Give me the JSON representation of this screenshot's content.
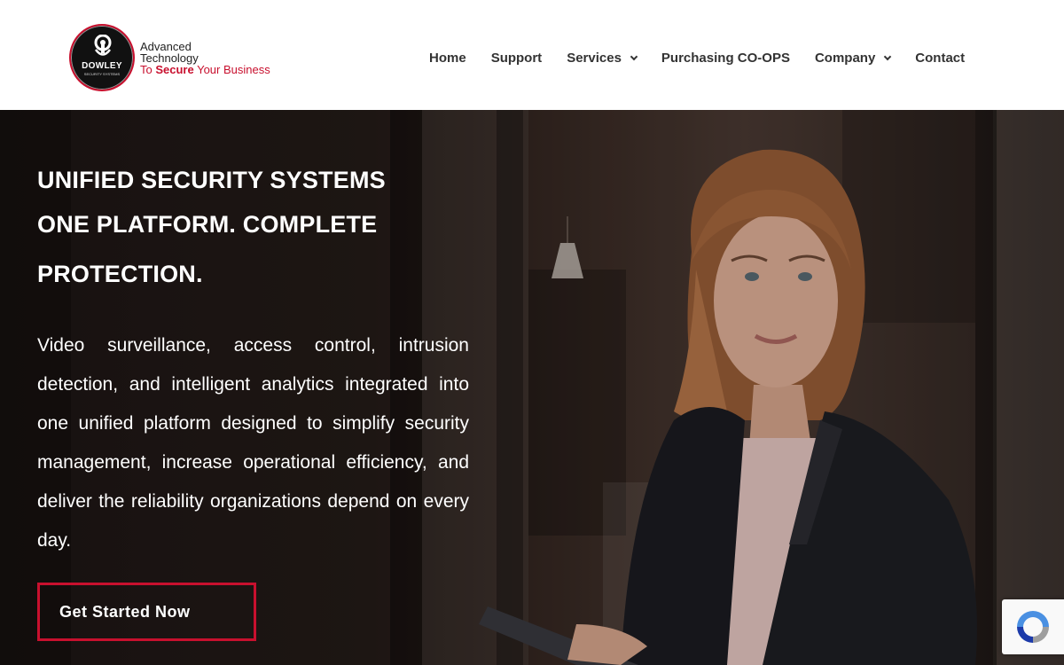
{
  "logo": {
    "brand": "DOWLEY",
    "brand_sub": "SECURITY SYSTEMS",
    "tagline_line1": "Advanced",
    "tagline_line2": "Technology",
    "tagline_line3_prefix": "To ",
    "tagline_line3_bold": "Secure",
    "tagline_line3_suffix": " Your Business"
  },
  "nav": {
    "items": [
      {
        "label": "Home"
      },
      {
        "label": "Support"
      },
      {
        "label": "Services"
      },
      {
        "label": "Purchasing CO-OPS"
      },
      {
        "label": "Company"
      },
      {
        "label": "Contact"
      }
    ]
  },
  "hero": {
    "title_line1": "UNIFIED SECURITY SYSTEMS",
    "title_line2": "ONE PLATFORM. COMPLETE",
    "title_line3": "PROTECTION.",
    "body": "Video surveillance, access control, intrusion detection, and intelligent analytics integrated into one unified platform designed to simplify security management, increase operational efficiency, and deliver the reliability organizations depend on every day.",
    "cta_label": "Get Started Now"
  },
  "colors": {
    "accent": "#c8102e",
    "nav_text": "#333333",
    "hero_text": "#ffffff"
  },
  "icons": {
    "dropdown": "chevron-down-icon",
    "recaptcha": "recaptcha-icon",
    "logo": "keyhole-icon"
  }
}
